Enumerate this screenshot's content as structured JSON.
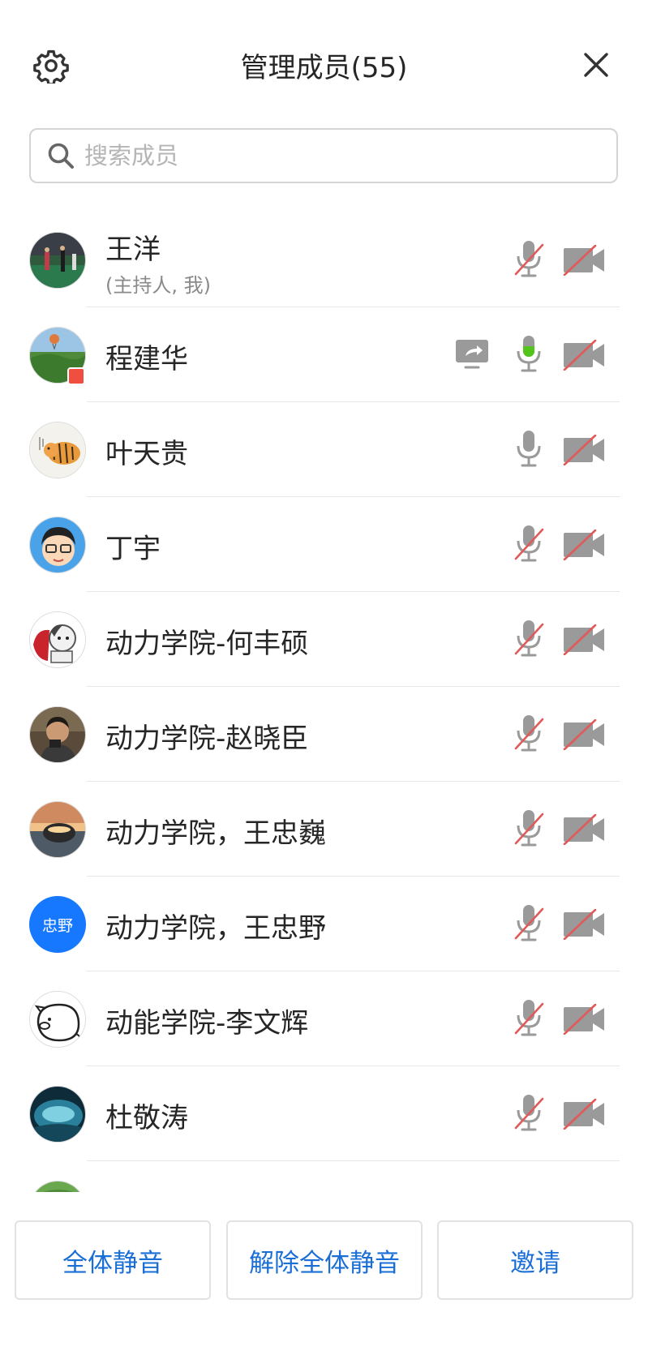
{
  "header": {
    "title": "管理成员(55)",
    "settings_icon": "gear-icon",
    "close_icon": "close-icon"
  },
  "search": {
    "placeholder": "搜索成员",
    "value": "",
    "icon": "search-icon"
  },
  "colors": {
    "accent": "#1a6fd6",
    "mute_slash": "#e05a5a",
    "icon_gray": "#9a9a9a",
    "speaking_green": "#52c41a",
    "avatar_blue": "#1677ff"
  },
  "members": [
    {
      "name": "王洋",
      "role": "(主持人, 我)",
      "mic": "muted",
      "camera": "off",
      "sharing": false,
      "avatar": "photo-sports-field"
    },
    {
      "name": "程建华",
      "role": "",
      "mic": "speaking",
      "camera": "off",
      "sharing": true,
      "avatar": "photo-landscape-balloon"
    },
    {
      "name": "叶天贵",
      "role": "",
      "mic": "on",
      "camera": "off",
      "sharing": false,
      "avatar": "drawing-tiger"
    },
    {
      "name": "丁宇",
      "role": "",
      "mic": "muted",
      "camera": "off",
      "sharing": false,
      "avatar": "cartoon-boy-glasses"
    },
    {
      "name": "动力学院-何丰硕",
      "role": "",
      "mic": "muted",
      "camera": "off",
      "sharing": false,
      "avatar": "cartoon-cat"
    },
    {
      "name": "动力学院-赵晓臣",
      "role": "",
      "mic": "muted",
      "camera": "off",
      "sharing": false,
      "avatar": "photo-man"
    },
    {
      "name": "动力学院，王忠巍",
      "role": "",
      "mic": "muted",
      "camera": "off",
      "sharing": false,
      "avatar": "photo-sunset"
    },
    {
      "name": "动力学院，王忠野",
      "role": "",
      "mic": "muted",
      "camera": "off",
      "sharing": false,
      "avatar_text": "忠野"
    },
    {
      "name": "动能学院-李文辉",
      "role": "",
      "mic": "muted",
      "camera": "off",
      "sharing": false,
      "avatar": "sketch-pig"
    },
    {
      "name": "杜敬涛",
      "role": "",
      "mic": "muted",
      "camera": "off",
      "sharing": false,
      "avatar": "photo-ice-cave"
    }
  ],
  "footer": {
    "mute_all": "全体静音",
    "unmute_all": "解除全体静音",
    "invite": "邀请"
  }
}
